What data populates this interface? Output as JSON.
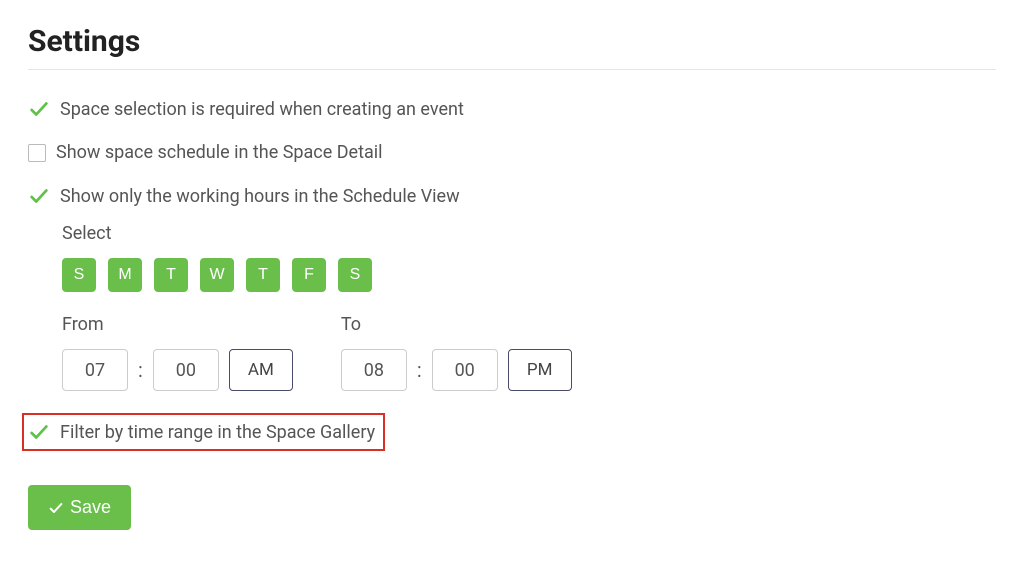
{
  "title": "Settings",
  "options": {
    "space_selection_required": {
      "label": "Space selection is required when creating an event",
      "checked": true
    },
    "show_space_schedule": {
      "label": "Show space schedule in the Space Detail",
      "checked": false
    },
    "show_working_hours": {
      "label": "Show only the working hours in the Schedule View",
      "checked": true
    },
    "filter_time_range": {
      "label": "Filter by time range in the Space Gallery",
      "checked": true
    }
  },
  "schedule": {
    "select_label": "Select",
    "days": [
      "S",
      "M",
      "T",
      "W",
      "T",
      "F",
      "S"
    ],
    "from_label": "From",
    "to_label": "To",
    "from_hour": "07",
    "from_min": "00",
    "from_ampm": "AM",
    "to_hour": "08",
    "to_min": "00",
    "to_ampm": "PM"
  },
  "save_label": "Save"
}
